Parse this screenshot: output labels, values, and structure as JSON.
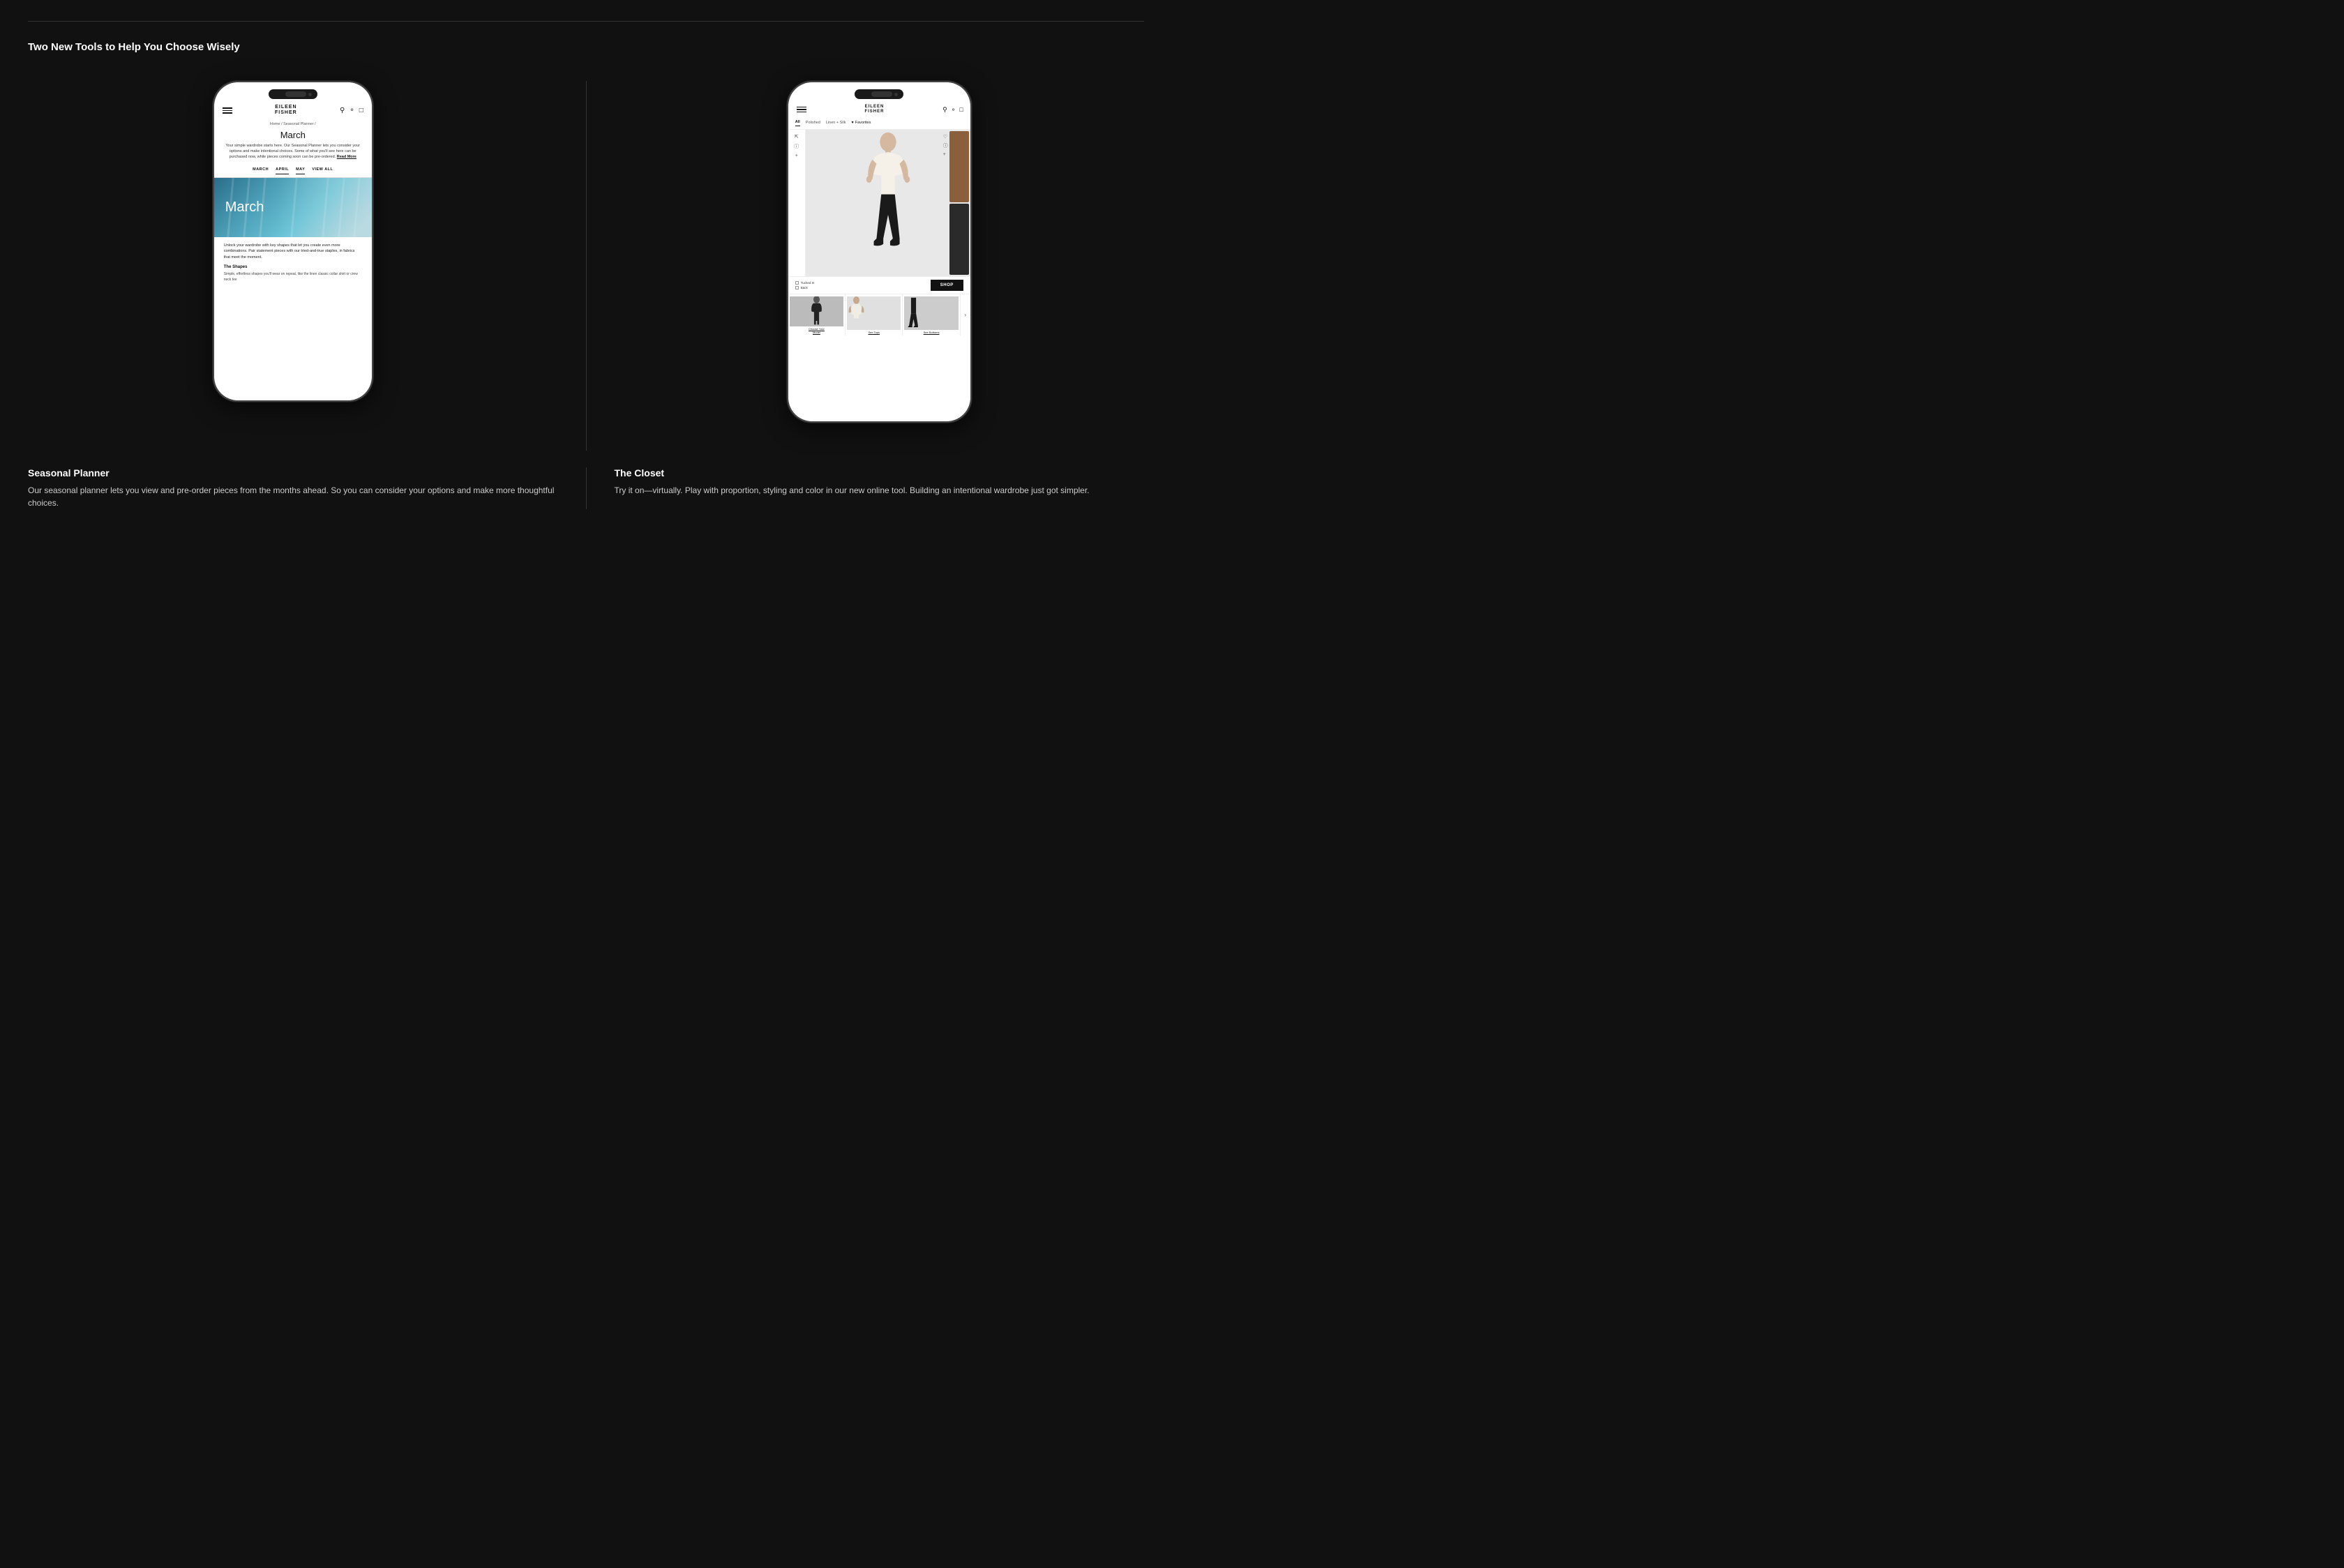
{
  "page": {
    "title": "Two New Tools to Help You Choose Wisely"
  },
  "left_phone": {
    "brand": "EILEEN\nFISHER",
    "breadcrumb": "Home / Seasonal Planner /",
    "screen_title": "March",
    "description": "Your simple wardrobe starts here. Our Seasonal Planner lets you consider your options and make intentional choices. Some of what you'll see here can be purchased now, while pieces coming soon can be pre-ordered.",
    "read_more": "Read More",
    "tabs": [
      "MARCH",
      "APRIL",
      "MAY",
      "VIEW ALL"
    ],
    "active_tab": "APRIL",
    "hero_text": "March",
    "body_heading": "The Shapes",
    "body_text": "Unlock your wardrobe with key shapes that let you create even more combinations. Pair statement pieces with our tried-and-true staples, in fabrics that meet the moment.",
    "body_subtext": "Simple, effortless shapes you'll wear on repeat, like the linen classic collar shirt or crew neck tee"
  },
  "right_phone": {
    "brand": "EILEEN\nFISHER",
    "filter_tabs": [
      "All",
      "Polished",
      "Linen + Silk",
      "Favorites"
    ],
    "active_filter": "All",
    "checkboxes": [
      "Tucked In",
      "Back"
    ],
    "shop_btn": "SHOP",
    "thumbnails": [
      {
        "label": "Choose Your\nModel"
      },
      {
        "label": "See Tops"
      },
      {
        "label": "See Bottoms"
      }
    ],
    "right_color_1": "#8B5E3C",
    "right_color_2": "#2a2a2a"
  },
  "bottom": {
    "left_title": "Seasonal Planner",
    "left_desc": "Our seasonal planner lets you view and pre-order pieces from the months ahead.\nSo you can consider your options and make more thoughtful choices.",
    "right_title": "The Closet",
    "right_desc": "Try it on—virtually. Play with proportion, styling and color in our new\nonline tool. Building an intentional wardrobe just got simpler."
  }
}
